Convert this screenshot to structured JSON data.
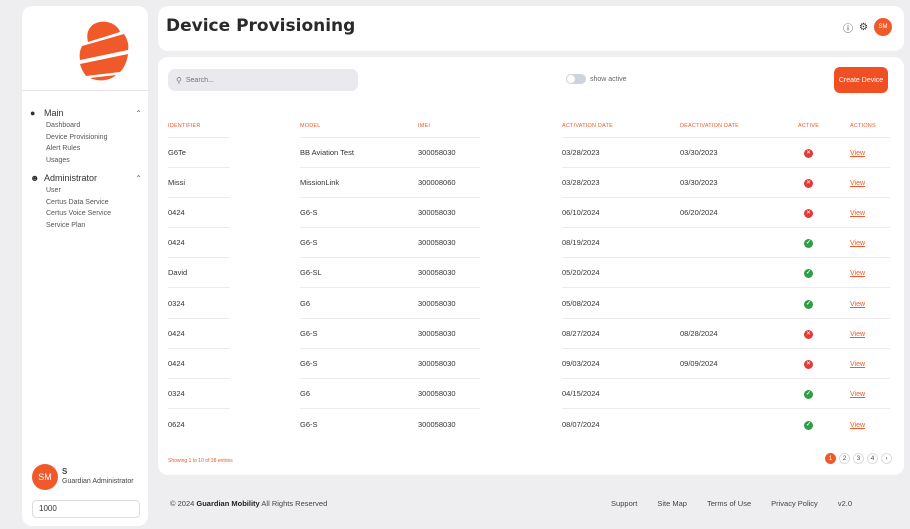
{
  "sidebar": {
    "sections": [
      {
        "title": "Main",
        "items": [
          "Dashboard",
          "Device Provisioning",
          "Alert Rules",
          "Usages"
        ]
      },
      {
        "title": "Administrator",
        "items": [
          "User",
          "Certus Data Service",
          "Certus Voice Service",
          "Service Plan"
        ]
      }
    ],
    "user": {
      "initials": "SM",
      "name": "S",
      "role": "Guardian Administrator",
      "id": "1000"
    }
  },
  "header": {
    "title": "Device Provisioning",
    "avatar_initials": "SM"
  },
  "toolbar": {
    "search_placeholder": "Search...",
    "toggle_label": "show active",
    "create_label": "Create Device"
  },
  "table": {
    "columns": [
      "Identifier",
      "Model",
      "IMEI",
      "Activation Date",
      "Deactivation Date",
      "Active",
      "Actions"
    ],
    "rows": [
      {
        "identifier": "G6Te",
        "model": "BB Aviation Test",
        "imei": "300058030",
        "activation": "03/28/2023",
        "deactivation": "03/30/2023",
        "active": false,
        "action": "View"
      },
      {
        "identifier": "Missi",
        "model": "MissionLink",
        "imei": "300008060",
        "activation": "03/28/2023",
        "deactivation": "03/30/2023",
        "active": false,
        "action": "View"
      },
      {
        "identifier": "0424",
        "model": "G6-S",
        "imei": "300058030",
        "activation": "06/10/2024",
        "deactivation": "06/20/2024",
        "active": false,
        "action": "View"
      },
      {
        "identifier": "0424",
        "model": "G6-S",
        "imei": "300058030",
        "activation": "08/19/2024",
        "deactivation": "",
        "active": true,
        "action": "View"
      },
      {
        "identifier": "David",
        "model": "G6-SL",
        "imei": "300058030",
        "activation": "05/20/2024",
        "deactivation": "",
        "active": true,
        "action": "View"
      },
      {
        "identifier": "0324",
        "model": "G6",
        "imei": "300058030",
        "activation": "05/08/2024",
        "deactivation": "",
        "active": true,
        "action": "View"
      },
      {
        "identifier": "0424",
        "model": "G6-S",
        "imei": "300058030",
        "activation": "08/27/2024",
        "deactivation": "08/28/2024",
        "active": false,
        "action": "View"
      },
      {
        "identifier": "0424",
        "model": "G6-S",
        "imei": "300058030",
        "activation": "09/03/2024",
        "deactivation": "09/09/2024",
        "active": false,
        "action": "View"
      },
      {
        "identifier": "0324",
        "model": "G6",
        "imei": "300058030",
        "activation": "04/15/2024",
        "deactivation": "",
        "active": true,
        "action": "View"
      },
      {
        "identifier": "0624",
        "model": "G6-S",
        "imei": "300058030",
        "activation": "08/07/2024",
        "deactivation": "",
        "active": true,
        "action": "View"
      }
    ]
  },
  "pagination": {
    "summary": "Showing 1 to 10 of 38 entries",
    "pages": [
      "1",
      "2",
      "3",
      "4",
      "›"
    ],
    "current": "1"
  },
  "footer": {
    "copyright_prefix": "© 2024",
    "brand": "Guardian Mobility",
    "copyright_suffix": "All Rights Reserved",
    "links": [
      "Support",
      "Site Map",
      "Terms of Use",
      "Privacy Policy",
      "v2.0"
    ]
  },
  "colors": {
    "accent": "#f05a2a",
    "inactive": "#e53935",
    "active": "#2e9e45"
  }
}
